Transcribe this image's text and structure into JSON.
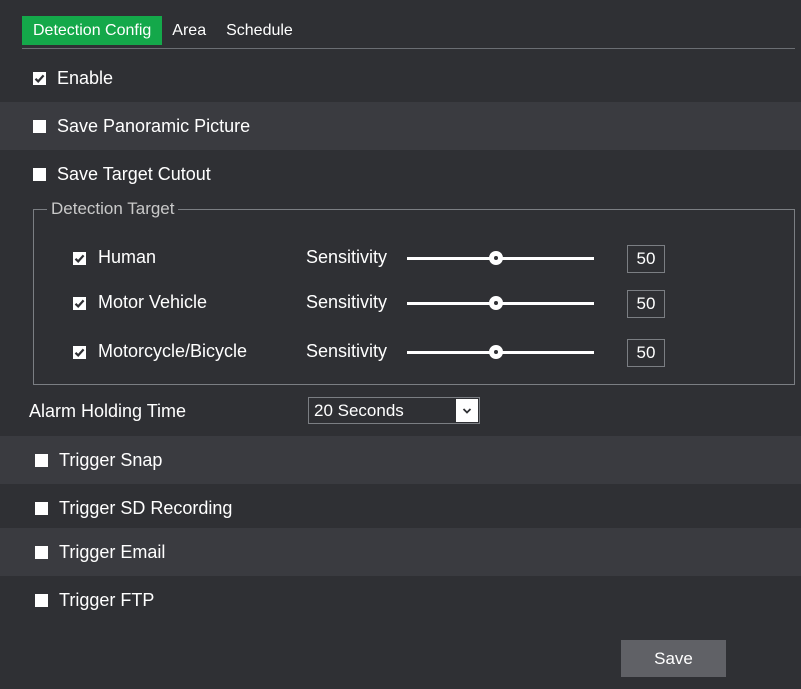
{
  "tabs": [
    {
      "label": "Detection Config",
      "active": true
    },
    {
      "label": "Area",
      "active": false
    },
    {
      "label": "Schedule",
      "active": false
    }
  ],
  "options": {
    "enable": {
      "label": "Enable",
      "checked": true
    },
    "save_panoramic": {
      "label": "Save Panoramic Picture",
      "checked": false
    },
    "save_target_cutout": {
      "label": "Save Target Cutout",
      "checked": false
    }
  },
  "detection_target": {
    "legend": "Detection Target",
    "sensitivity_label": "Sensitivity",
    "targets": [
      {
        "label": "Human",
        "checked": true,
        "sensitivity": "50"
      },
      {
        "label": "Motor Vehicle",
        "checked": true,
        "sensitivity": "50"
      },
      {
        "label": "Motorcycle/Bicycle",
        "checked": true,
        "sensitivity": "50"
      }
    ]
  },
  "alarm_holding_time": {
    "label": "Alarm Holding Time",
    "value": "20 Seconds"
  },
  "triggers": [
    {
      "label": "Trigger Snap",
      "checked": false
    },
    {
      "label": "Trigger SD Recording",
      "checked": false
    },
    {
      "label": "Trigger Email",
      "checked": false
    },
    {
      "label": "Trigger FTP",
      "checked": false
    }
  ],
  "save_label": "Save",
  "colors": {
    "background": "#2f3034",
    "row_alt": "#3a3b40",
    "active_tab": "#14a84a",
    "button": "#606166"
  },
  "icons": {
    "checked": "checkbox-checked-icon",
    "unchecked": "checkbox-unchecked-icon",
    "dropdown": "chevron-down-icon",
    "slider_thumb": "slider-thumb-icon"
  }
}
